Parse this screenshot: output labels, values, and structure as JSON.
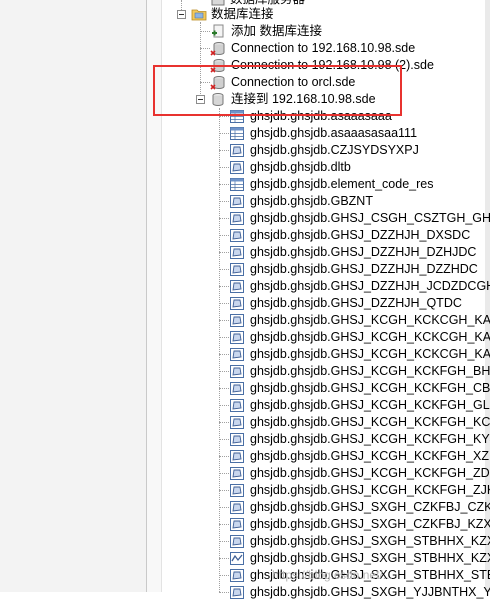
{
  "tree": {
    "top_partial_label": "数据库服务器",
    "db_connections_folder": {
      "label": "数据库连接"
    },
    "connections": [
      {
        "label": "添加 数据库连接",
        "icon": "add-connection-icon"
      },
      {
        "label": "Connection to 192.168.10.98.sde",
        "icon": "disconnected-db-icon"
      },
      {
        "label": "Connection to 192.168.10.98 (2).sde",
        "icon": "disconnected-db-icon"
      },
      {
        "label": "Connection to orcl.sde",
        "icon": "disconnected-db-icon"
      },
      {
        "label": "连接到 192.168.10.98.sde",
        "icon": "connected-db-icon"
      }
    ],
    "tables": [
      {
        "label": "ghsjdb.ghsjdb.asaaasaaa",
        "icon": "table-icon"
      },
      {
        "label": "ghsjdb.ghsjdb.asaaasasaa111",
        "icon": "table-icon"
      },
      {
        "label": "ghsjdb.ghsjdb.CZJSYDSYXPJ",
        "icon": "polygon-feature-class-icon"
      },
      {
        "label": "ghsjdb.ghsjdb.dltb",
        "icon": "polygon-feature-class-icon"
      },
      {
        "label": "ghsjdb.ghsjdb.element_code_res",
        "icon": "table-icon"
      },
      {
        "label": "ghsjdb.ghsjdb.GBZNT",
        "icon": "polygon-feature-class-icon"
      },
      {
        "label": "ghsjdb.ghsjdb.GHSJ_CSGH_CSZTGH_GHQ",
        "icon": "polygon-feature-class-icon"
      },
      {
        "label": "ghsjdb.ghsjdb.GHSJ_DZZHJH_DXSDC",
        "icon": "polygon-feature-class-icon"
      },
      {
        "label": "ghsjdb.ghsjdb.GHSJ_DZZHJH_DZHJDC",
        "icon": "polygon-feature-class-icon"
      },
      {
        "label": "ghsjdb.ghsjdb.GHSJ_DZZHJH_DZZHDC",
        "icon": "polygon-feature-class-icon"
      },
      {
        "label": "ghsjdb.ghsjdb.GHSJ_DZZHJH_JCDZDCGHC",
        "icon": "polygon-feature-class-icon"
      },
      {
        "label": "ghsjdb.ghsjdb.GHSJ_DZZHJH_QTDC",
        "icon": "polygon-feature-class-icon"
      },
      {
        "label": "ghsjdb.ghsjdb.GHSJ_KCGH_KCKCGH_KAN",
        "icon": "polygon-feature-class-icon"
      },
      {
        "label": "ghsjdb.ghsjdb.GHSJ_KCGH_KCKCGH_KAN",
        "icon": "polygon-feature-class-icon"
      },
      {
        "label": "ghsjdb.ghsjdb.GHSJ_KCGH_KCKCGH_KAN",
        "icon": "polygon-feature-class-icon"
      },
      {
        "label": "ghsjdb.ghsjdb.GHSJ_KCGH_KCKFGH_BHQ",
        "icon": "polygon-feature-class-icon"
      },
      {
        "label": "ghsjdb.ghsjdb.GHSJ_KCGH_KCKFGH_CBQ",
        "icon": "polygon-feature-class-icon"
      },
      {
        "label": "ghsjdb.ghsjdb.GHSJ_KCGH_KCKFGH_GLKC",
        "icon": "polygon-feature-class-icon"
      },
      {
        "label": "ghsjdb.ghsjdb.GHSJ_KCGH_KCKFGH_KCGH",
        "icon": "polygon-feature-class-icon"
      },
      {
        "label": "ghsjdb.ghsjdb.GHSJ_KCGH_KCKFGH_KYJJQ",
        "icon": "polygon-feature-class-icon"
      },
      {
        "label": "ghsjdb.ghsjdb.GHSJ_KCGH_KCKFGH_XZKC",
        "icon": "polygon-feature-class-icon"
      },
      {
        "label": "ghsjdb.ghsjdb.GHSJ_KCGH_KCKFGH_ZDKC",
        "icon": "polygon-feature-class-icon"
      },
      {
        "label": "ghsjdb.ghsjdb.GHSJ_KCGH_KCKFGH_ZJKC",
        "icon": "polygon-feature-class-icon"
      },
      {
        "label": "ghsjdb.ghsjdb.GHSJ_SXGH_CZKFBJ_CZKFB",
        "icon": "polygon-feature-class-icon"
      },
      {
        "label": "ghsjdb.ghsjdb.GHSJ_SXGH_CZKFBJ_KZX_C",
        "icon": "polygon-feature-class-icon"
      },
      {
        "label": "ghsjdb.ghsjdb.GHSJ_SXGH_STBHHX_KZX_",
        "icon": "polygon-feature-class-icon"
      },
      {
        "label": "ghsjdb.ghsjdb.GHSJ_SXGH_STBHHX_KZX_",
        "icon": "line-feature-class-icon"
      },
      {
        "label": "ghsjdb.ghsjdb.GHSJ_SXGH_STBHHX_STBH",
        "icon": "polygon-feature-class-icon"
      },
      {
        "label": "ghsjdb.ghsjdb.GHSJ_SXGH_YJJBNTHX_YJJ",
        "icon": "polygon-feature-class-icon"
      }
    ]
  },
  "watermark": "https://blog.csdn.net/...",
  "colors": {
    "highlight": "#e8322f",
    "folder": "#e8b53a",
    "db": "#9a9a9a"
  }
}
